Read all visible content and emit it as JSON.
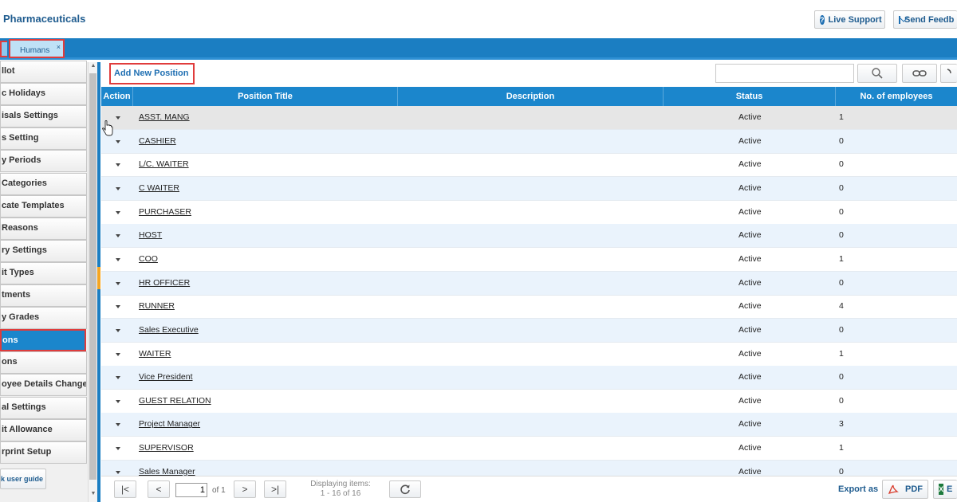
{
  "header": {
    "brand": "Pharmaceuticals",
    "live_support": "Live Support",
    "send_feedback": "Send Feedb"
  },
  "tabs": [
    {
      "label": "Humans",
      "close": "×"
    }
  ],
  "sidebar": {
    "items": [
      {
        "label": "llot"
      },
      {
        "label": "c Holidays"
      },
      {
        "label": "isals Settings"
      },
      {
        "label": "s Setting"
      },
      {
        "label": "y Periods"
      },
      {
        "label": "Categories"
      },
      {
        "label": "cate Templates"
      },
      {
        "label": "Reasons"
      },
      {
        "label": "ry Settings"
      },
      {
        "label": "it Types"
      },
      {
        "label": "tments"
      },
      {
        "label": "y Grades"
      },
      {
        "label": "ons",
        "active": true
      },
      {
        "label": "ons"
      },
      {
        "label": "oyee Details Changes"
      },
      {
        "label": "al Settings"
      },
      {
        "label": "it Allowance"
      },
      {
        "label": "rprint Setup"
      }
    ],
    "guide": "k user guide"
  },
  "toolbar": {
    "add_label": "Add New Position",
    "search_placeholder": ""
  },
  "grid": {
    "columns": [
      "Action",
      "Position Title",
      "Description",
      "Status",
      "No. of employees"
    ],
    "rows": [
      {
        "title": "ASST. MANG",
        "description": "",
        "status": "Active",
        "count": "1"
      },
      {
        "title": "CASHIER",
        "description": "",
        "status": "Active",
        "count": "0"
      },
      {
        "title": "L/C. WAITER",
        "description": "",
        "status": "Active",
        "count": "0"
      },
      {
        "title": "C WAITER",
        "description": "",
        "status": "Active",
        "count": "0"
      },
      {
        "title": "PURCHASER",
        "description": "",
        "status": "Active",
        "count": "0"
      },
      {
        "title": "HOST",
        "description": "",
        "status": "Active",
        "count": "0"
      },
      {
        "title": "COO",
        "description": "",
        "status": "Active",
        "count": "1"
      },
      {
        "title": "HR OFFICER",
        "description": "",
        "status": "Active",
        "count": "0"
      },
      {
        "title": "RUNNER",
        "description": "",
        "status": "Active",
        "count": "4"
      },
      {
        "title": "Sales Executive",
        "description": "",
        "status": "Active",
        "count": "0"
      },
      {
        "title": "WAITER",
        "description": "",
        "status": "Active",
        "count": "1"
      },
      {
        "title": "Vice President",
        "description": "",
        "status": "Active",
        "count": "0"
      },
      {
        "title": "GUEST RELATION",
        "description": "",
        "status": "Active",
        "count": "0"
      },
      {
        "title": "Project Manager",
        "description": "",
        "status": "Active",
        "count": "3"
      },
      {
        "title": "SUPERVISOR",
        "description": "",
        "status": "Active",
        "count": "1"
      },
      {
        "title": "Sales Manager",
        "description": "",
        "status": "Active",
        "count": "0"
      }
    ]
  },
  "pager": {
    "first": "|<",
    "prev": "<",
    "next": ">",
    "last": ">|",
    "page": "1",
    "of": "of 1",
    "display_line1": "Displaying items:",
    "display_line2": "1 - 16 of 16"
  },
  "export": {
    "label": "Export as",
    "pdf": "PDF",
    "excel": "E"
  },
  "colors": {
    "primary": "#1b86cc",
    "highlight": "#e03c3c",
    "row_alt": "#eaf3fc"
  }
}
